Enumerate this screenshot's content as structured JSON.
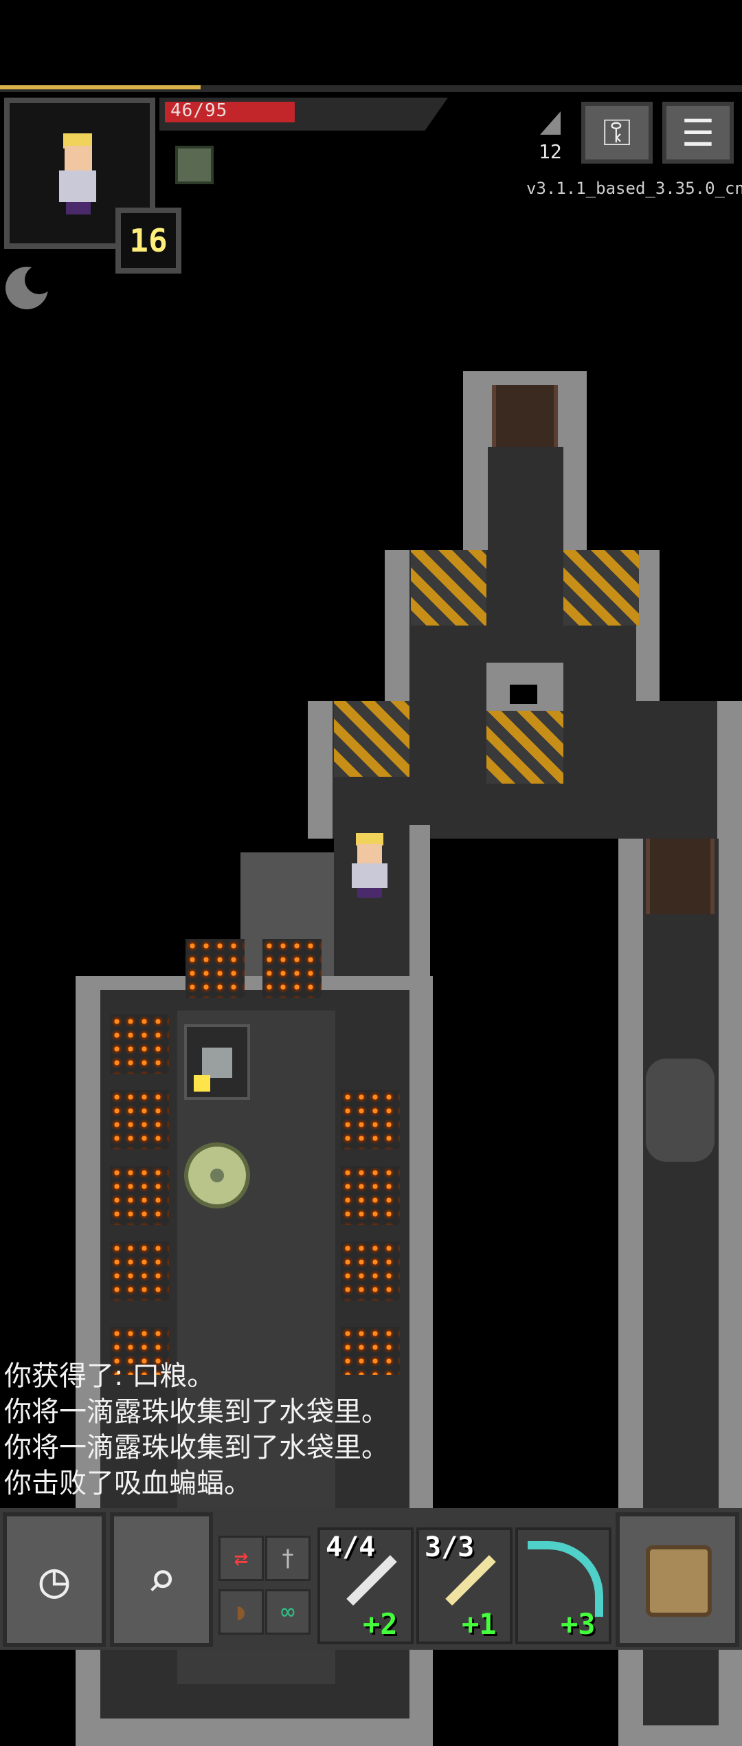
{
  "hud": {
    "hp_text": "46/95",
    "hp_fraction": 0.484,
    "xp_fraction": 0.27,
    "level": "16",
    "depth": "12",
    "version": "v3.1.1_based_3.35.0_cn",
    "journal_icon": "keys-icon",
    "menu_icon": "menu-icon",
    "buff_icon": "head-buff-icon"
  },
  "log": {
    "lines": [
      "你获得了: 口粮。",
      "你将一滴露珠收集到了水袋里。",
      "你将一滴露珠收集到了水袋里。",
      "你击败了吸血蝙蝠。"
    ]
  },
  "toolbar": {
    "wait_icon": "clock-icon",
    "search_icon": "magnifier-icon",
    "quickslots": [
      {
        "count": "4/4",
        "upgrade": "+2",
        "icon": "wand-icon"
      },
      {
        "count": "3/3",
        "upgrade": "+1",
        "icon": "wand-icon"
      },
      {
        "count": "",
        "upgrade": "+3",
        "icon": "bow-icon"
      }
    ],
    "backpack_icon": "backpack-icon"
  },
  "colors": {
    "hp": "#c2262b",
    "xp": "#d9b24a",
    "upgrade": "#44ff3b",
    "level": "#ffef7a"
  }
}
